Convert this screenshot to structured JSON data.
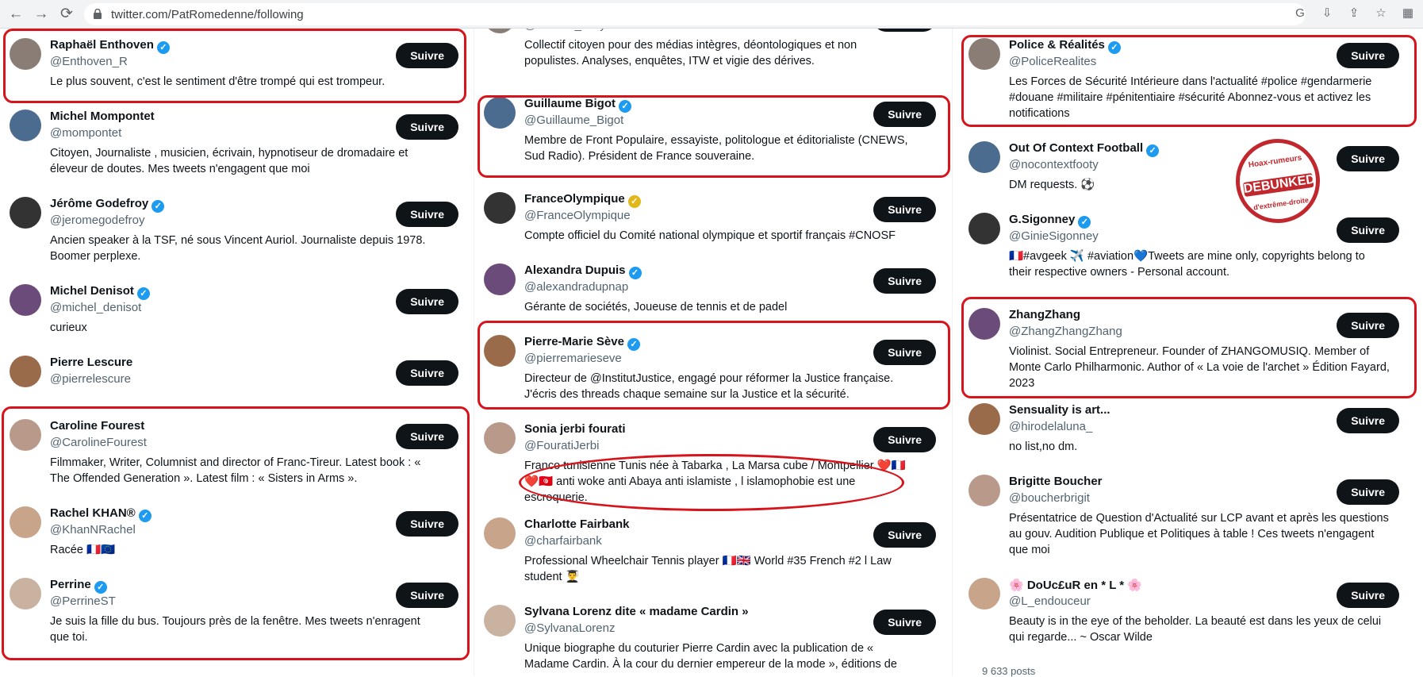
{
  "browser": {
    "url": "twitter.com/PatRomedenne/following",
    "back": "←",
    "forward": "→",
    "reload": "⟳",
    "icons": [
      "google-icon",
      "download-icon",
      "share-icon",
      "star-icon",
      "extension-icon"
    ]
  },
  "follow_label": "Suivre",
  "col1": [
    {
      "name": "Raphaël Enthoven",
      "verified": true,
      "handle": "@Enthoven_R",
      "bio": [
        "Le plus souvent, c'est le sentiment d'être trompé qui est trompeur."
      ]
    },
    {
      "name": "Michel Mompontet",
      "verified": false,
      "handle": "@mompontet",
      "bio": [
        "Citoyen, Journaliste , musicien, écrivain, hypnotiseur de dromadaire et",
        "éleveur de doutes. Mes tweets n'engagent que moi"
      ]
    },
    {
      "name": "Jérôme Godefroy",
      "verified": true,
      "handle": "@jeromegodefroy",
      "bio": [
        "Ancien speaker à la TSF, né sous Vincent Auriol. Journaliste depuis 1978.",
        "Boomer perplexe."
      ]
    },
    {
      "name": "Michel Denisot",
      "verified": true,
      "handle": "@michel_denisot",
      "bio": [
        "curieux"
      ]
    },
    {
      "name": "Pierre Lescure",
      "verified": false,
      "handle": "@pierrelescure",
      "bio": []
    },
    {
      "name": "Caroline Fourest",
      "verified": false,
      "handle": "@CarolineFourest",
      "bio": [
        "Filmmaker, Writer, Columnist and director of Franc-Tireur. Latest book : «",
        "The Offended Generation ». Latest film : « Sisters in Arms »."
      ]
    },
    {
      "name": "Rachel KHAN®",
      "verified": true,
      "handle": "@KhanNRachel",
      "bio": [
        "Racée 🇫🇷🇪🇺"
      ]
    },
    {
      "name": "Perrine",
      "verified": true,
      "handle": "@PerrineST",
      "bio": [
        "Je suis la fille du bus. Toujours près de la fenêtre. Mes tweets n'enragent",
        "que toi."
      ]
    }
  ],
  "col2": [
    {
      "name": "",
      "verified": false,
      "handle": "@medias_citoyens",
      "bio": [
        "Collectif citoyen pour des médias intègres, déontologiques et non",
        "populistes. Analyses, enquêtes, ITW et vigie des dérives."
      ]
    },
    {
      "name": "Guillaume Bigot",
      "verified": true,
      "handle": "@Guillaume_Bigot",
      "bio": [
        "Membre de Front Populaire, essayiste, politologue et éditorialiste (CNEWS,",
        "Sud Radio). Président de France souveraine."
      ]
    },
    {
      "name": "FranceOlympique",
      "verified": true,
      "gold": true,
      "handle": "@FranceOlympique",
      "bio": [
        "Compte officiel du Comité national olympique et sportif français #CNOSF"
      ]
    },
    {
      "name": "Alexandra Dupuis",
      "verified": true,
      "handle": "@alexandradupnap",
      "bio": [
        "Gérante de sociétés, Joueuse de tennis et de padel"
      ]
    },
    {
      "name": "Pierre-Marie Sève",
      "verified": true,
      "handle": "@pierremarieseve",
      "bio": [
        "Directeur de @InstitutJustice, engagé pour réformer la Justice française.",
        "J'écris des threads chaque semaine sur la Justice et la sécurité."
      ]
    },
    {
      "name": "Sonia jerbi fourati",
      "verified": false,
      "handle": "@FouratiJerbi",
      "bio": [
        "Franco tunisienne Tunis née à Tabarka , La Marsa cube / Montpellier ❤️🇫🇷",
        "❤️🇹🇳 anti woke anti Abaya anti islamiste , l islamophobie est une",
        "escroquerie."
      ]
    },
    {
      "name": "Charlotte Fairbank",
      "verified": false,
      "handle": "@charfairbank",
      "bio": [
        "Professional Wheelchair Tennis player 🇫🇷🇬🇧 World #35 French #2 l Law",
        "student 👨‍🎓"
      ]
    },
    {
      "name": "Sylvana Lorenz dite « madame Cardin »",
      "verified": false,
      "handle": "@SylvanaLorenz",
      "bio": [
        "Unique biographe du couturier Pierre Cardin avec la publication de «",
        "Madame Cardin. À la cour du dernier empereur de la mode », éditions de"
      ]
    }
  ],
  "col3": [
    {
      "name": "Police & Réalités",
      "verified": true,
      "handle": "@PoliceRealites",
      "bio": [
        "Les Forces de Sécurité Intérieure dans l'actualité #police #gendarmerie",
        "#douane #militaire #pénitentiaire #sécurité Abonnez-vous et activez les",
        "notifications"
      ]
    },
    {
      "name": "Out Of Context Football",
      "verified": true,
      "handle": "@nocontextfooty",
      "bio": [
        "DM requests. ⚽"
      ]
    },
    {
      "name": "G.Sigonney",
      "verified": true,
      "handle": "@GinieSigonney",
      "bio": [
        "🇫🇷#avgeek ✈️ #aviation💙Tweets are mine only, copyrights belong to",
        "their respective owners - Personal account."
      ]
    },
    {
      "name": "ZhangZhang",
      "verified": false,
      "handle": "@ZhangZhangZhang",
      "bio": [
        "Violinist. Social Entrepreneur. Founder of ZHANGOMUSIQ. Member of",
        "Monte Carlo Philharmonic. Author of « La voie de l'archet » Édition Fayard,",
        "2023"
      ]
    },
    {
      "name": "Sensuality is art...",
      "verified": false,
      "handle": "@hirodelaluna_",
      "bio": [
        "no list,no dm."
      ]
    },
    {
      "name": "Brigitte Boucher",
      "verified": false,
      "handle": "@boucherbrigit",
      "bio": [
        "Présentatrice de Question d'Actualité sur LCP avant et après les questions",
        "au gouv. Audition Publique et Politiques à table ! Ces tweets n'engagent",
        "que moi"
      ]
    },
    {
      "name": "🌸 DoUc£uR en * L * 🌸",
      "verified": false,
      "handle": "@L_endouceur",
      "bio": [
        "Beauty is in the eye of the beholder. La beauté est dans les yeux de celui",
        "qui regarde... ~ Oscar Wilde"
      ]
    }
  ],
  "stamp": {
    "top": "Hoax-rumeurs",
    "middle": "DEBUNKED",
    "bottom": "d'extrême-droite"
  },
  "posts_count": "9 633 posts"
}
